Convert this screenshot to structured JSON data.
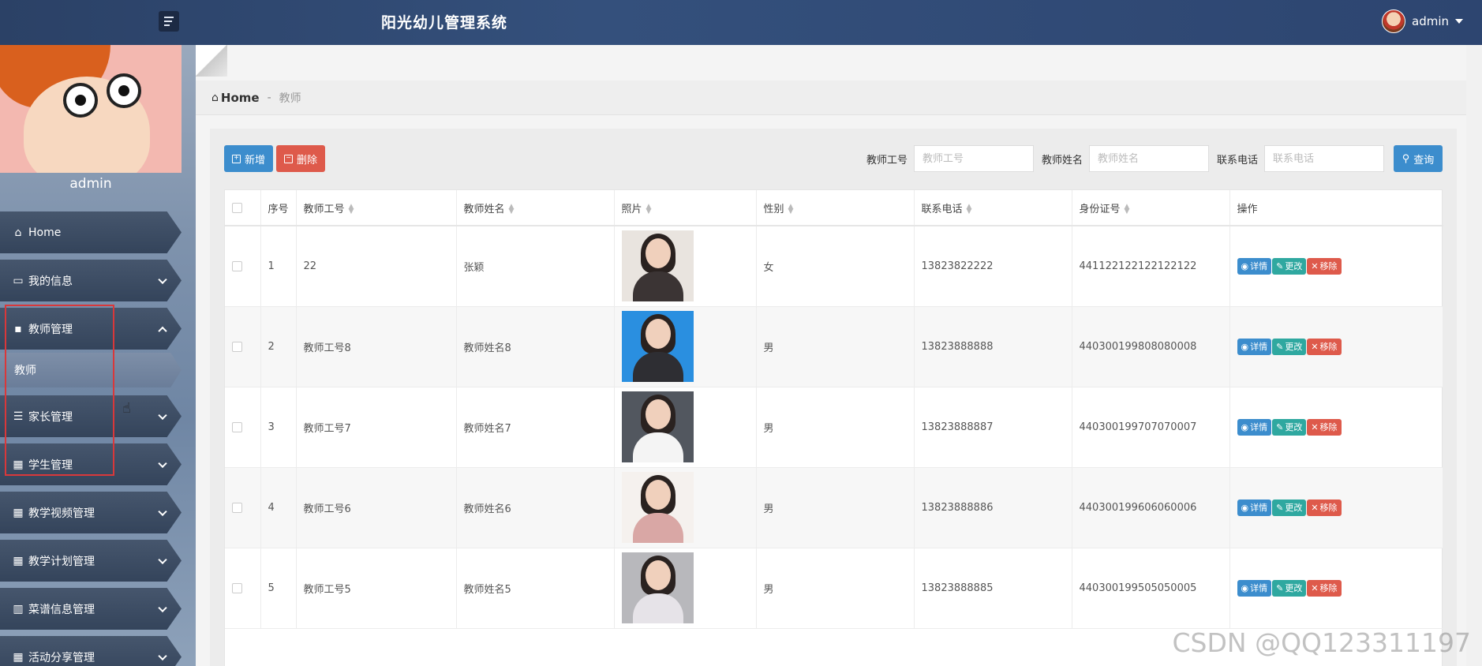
{
  "app": {
    "title": "阳光幼儿管理系统",
    "user": "admin"
  },
  "sidebar": {
    "profile_name": "admin",
    "items": [
      {
        "label": "Home",
        "icon": "home-icon"
      },
      {
        "label": "我的信息",
        "icon": "card-icon",
        "expandable": true
      },
      {
        "label": "教师管理",
        "icon": "chat-icon",
        "expandable": true,
        "expanded": true,
        "sub": [
          {
            "label": "教师"
          }
        ]
      },
      {
        "label": "家长管理",
        "icon": "list-icon",
        "expandable": true
      },
      {
        "label": "学生管理",
        "icon": "grid-icon",
        "expandable": true
      },
      {
        "label": "教学视频管理",
        "icon": "apps-icon",
        "expandable": true
      },
      {
        "label": "教学计划管理",
        "icon": "grid-icon",
        "expandable": true
      },
      {
        "label": "菜谱信息管理",
        "icon": "book-icon",
        "expandable": true
      },
      {
        "label": "活动分享管理",
        "icon": "grid-icon",
        "expandable": true
      }
    ]
  },
  "breadcrumb": {
    "home": "Home",
    "separator": "-",
    "current": "教师"
  },
  "toolbar": {
    "add_label": "新增",
    "delete_label": "删除",
    "search_label": "查询",
    "filters": [
      {
        "label": "教师工号",
        "placeholder": "教师工号"
      },
      {
        "label": "教师姓名",
        "placeholder": "教师姓名"
      },
      {
        "label": "联系电话",
        "placeholder": "联系电话"
      }
    ]
  },
  "table": {
    "columns": [
      "序号",
      "教师工号",
      "教师姓名",
      "照片",
      "性别",
      "联系电话",
      "身份证号",
      "操作"
    ],
    "actions": {
      "detail": "详情",
      "edit": "更改",
      "remove": "移除"
    },
    "rows": [
      {
        "index": "1",
        "teacher_no": "22",
        "name": "张颖",
        "gender": "女",
        "phone": "13823822222",
        "id_card": "441122122122122122",
        "photo_bg": "#e9e4df",
        "photo_top": "#3b3434"
      },
      {
        "index": "2",
        "teacher_no": "教师工号8",
        "name": "教师姓名8",
        "gender": "男",
        "phone": "13823888888",
        "id_card": "440300199808080008",
        "photo_bg": "#2a8fe0",
        "photo_top": "#2e2e33"
      },
      {
        "index": "3",
        "teacher_no": "教师工号7",
        "name": "教师姓名7",
        "gender": "男",
        "phone": "13823888887",
        "id_card": "440300199707070007",
        "photo_bg": "#52575f",
        "photo_top": "#f4f4f4"
      },
      {
        "index": "4",
        "teacher_no": "教师工号6",
        "name": "教师姓名6",
        "gender": "男",
        "phone": "13823888886",
        "id_card": "440300199606060006",
        "photo_bg": "#f5f1ee",
        "photo_top": "#d9a7a5"
      },
      {
        "index": "5",
        "teacher_no": "教师工号5",
        "name": "教师姓名5",
        "gender": "男",
        "phone": "13823888885",
        "id_card": "440300199505050005",
        "photo_bg": "#b8b8bc",
        "photo_top": "#e6e3e8"
      }
    ]
  },
  "watermark": "CSDN @QQ123311197"
}
